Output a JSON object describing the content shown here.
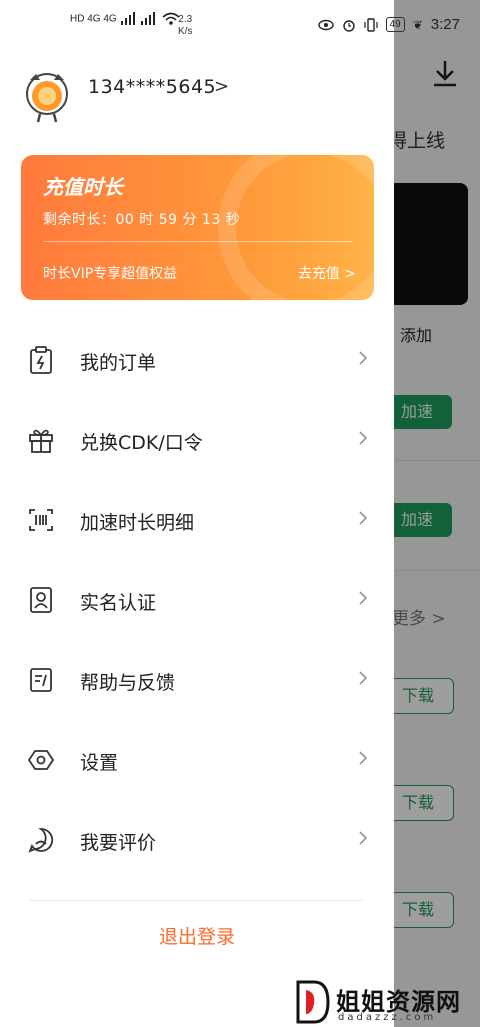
{
  "status_bar": {
    "network_left": "HD 4G 4G",
    "speed_value": "2.3",
    "speed_unit": "K/s",
    "battery": "49",
    "time": "3:27"
  },
  "background_app": {
    "online_text": "得上线",
    "add_label": "添加",
    "accelerate_label": "加速",
    "more_label": "更多 >",
    "download_label": "下载",
    "accent_color": "#1f9d5b"
  },
  "profile": {
    "phone": "134****5645",
    "chevron": ">"
  },
  "vip_card": {
    "title": "充值时长",
    "remaining": "剩余时长：00 时 59 分 13 秒",
    "benefit": "时长VIP专享超值权益",
    "recharge": "去充值 >",
    "gradient_start": "#ff7a3d",
    "gradient_end": "#ffb347"
  },
  "menu": [
    {
      "label": "我的订单",
      "icon": "clipboard-bolt-icon"
    },
    {
      "label": "兑换CDK/口令",
      "icon": "gift-icon"
    },
    {
      "label": "加速时长明细",
      "icon": "barcode-icon"
    },
    {
      "label": "实名认证",
      "icon": "id-card-icon"
    },
    {
      "label": "帮助与反馈",
      "icon": "feedback-note-icon"
    },
    {
      "label": "设置",
      "icon": "settings-hexagon-icon"
    },
    {
      "label": "我要评价",
      "icon": "chat-face-icon"
    }
  ],
  "logout": "退出登录",
  "logout_color": "#ff6a2b",
  "watermark": {
    "name": "姐姐资源网",
    "url": "dadazzz.com"
  }
}
